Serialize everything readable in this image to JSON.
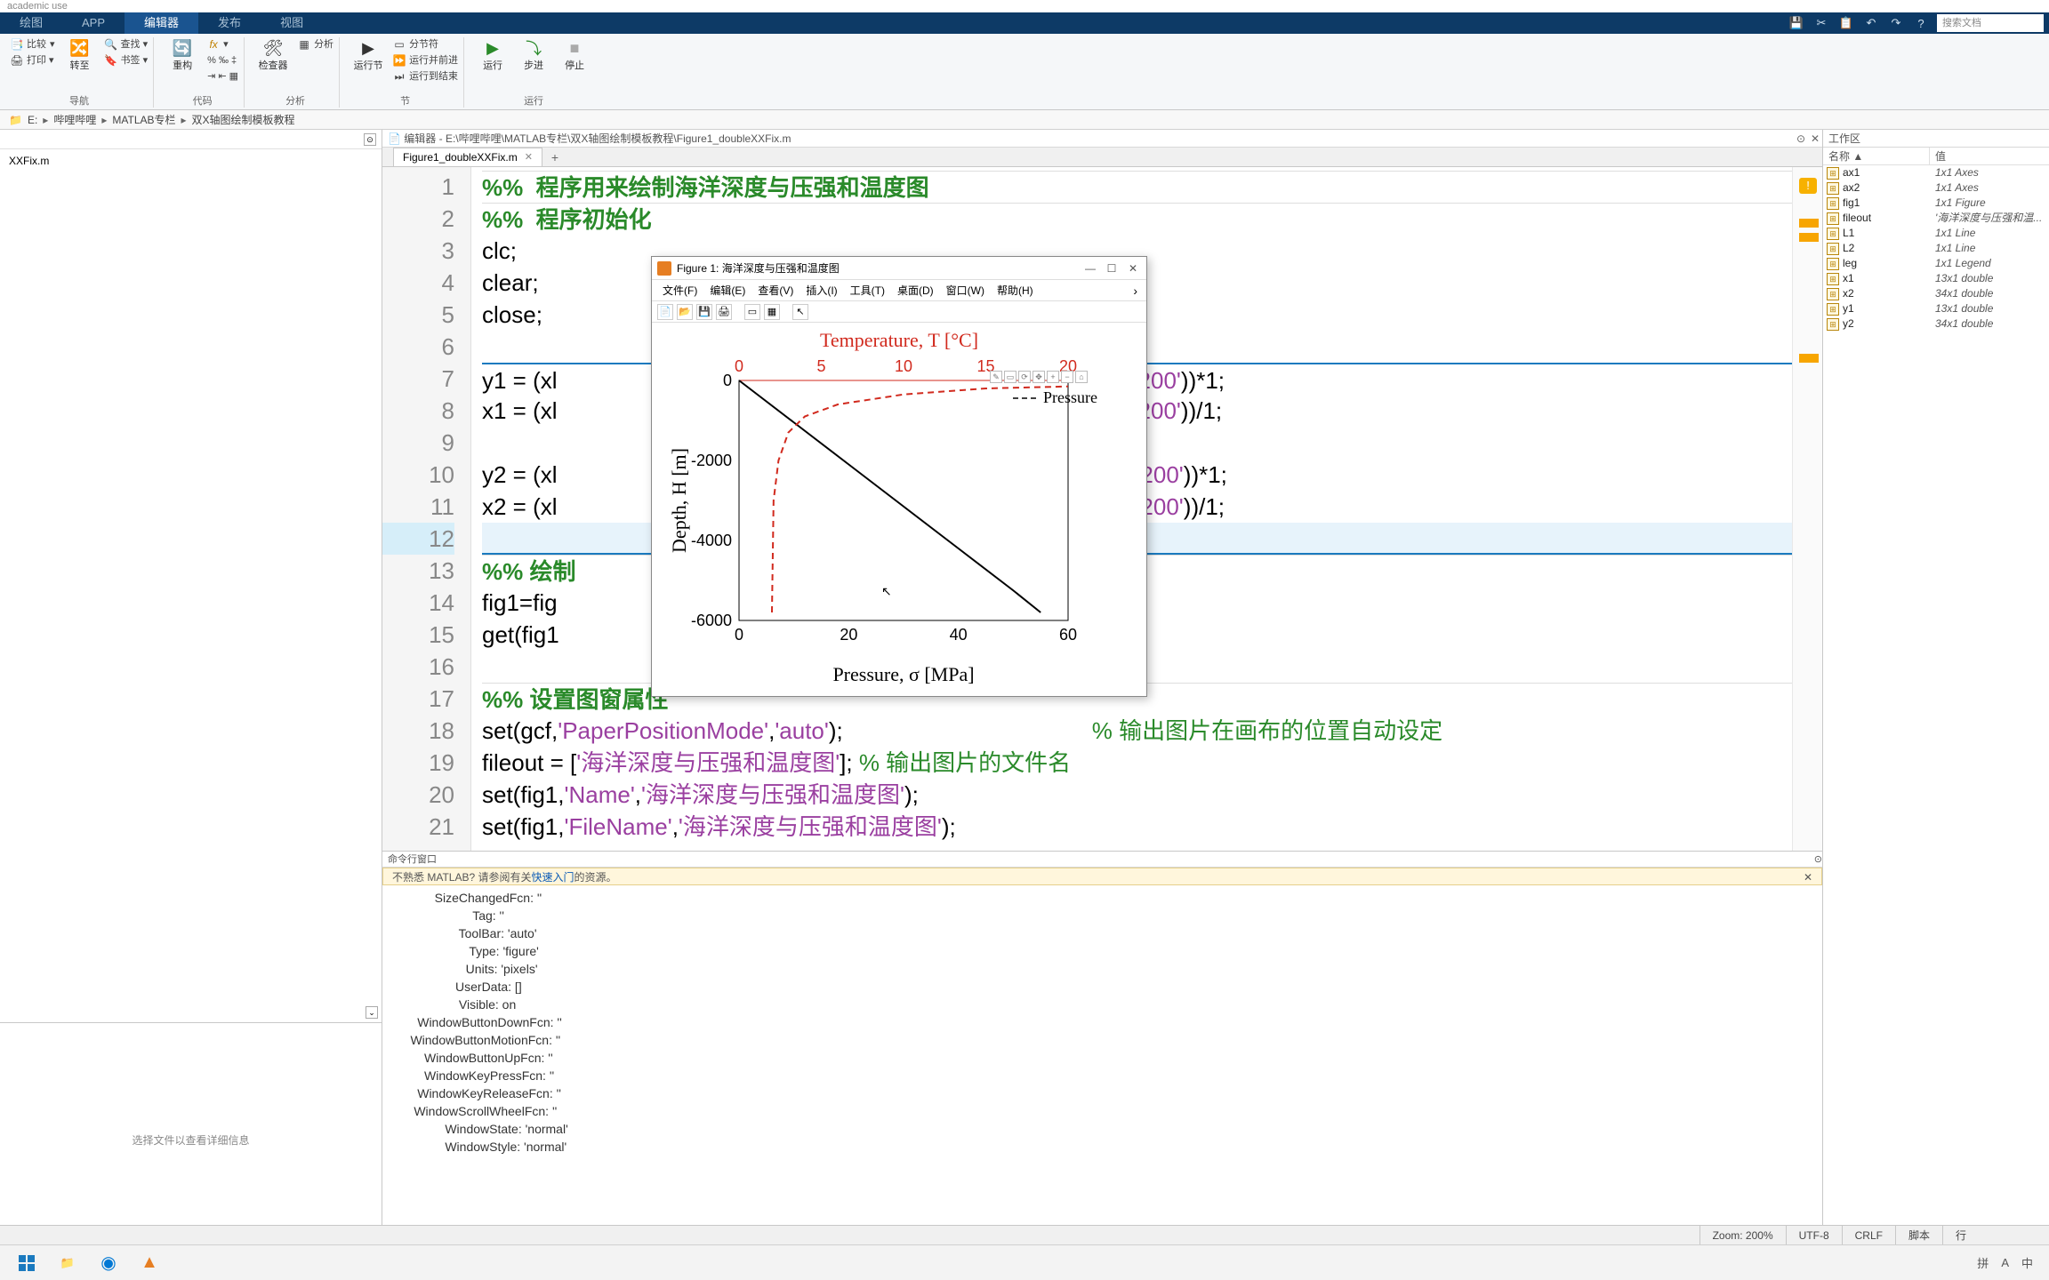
{
  "app_title": "academic use",
  "ribbon_tabs": {
    "t0": "绘图",
    "t1": "APP",
    "t2": "编辑器",
    "t3": "发布",
    "t4": "视图"
  },
  "ribbon_right": {
    "search_placeholder": "搜索文档"
  },
  "ribbon": {
    "file": {
      "compare": "比较",
      "compare_sub": "▾",
      "print": "打印 ▾",
      "goto": "转至",
      "find": "查找 ▾",
      "bookmark": "书签 ▾",
      "refactor": "重构",
      "lbl_file": "导航"
    },
    "code": {
      "fx": "fx",
      "pct": "% ‰ ‡",
      "indent": "⇥ ⇤ ▦",
      "lbl": "代码"
    },
    "analyze": {
      "checker": "检查器",
      "analyze": "分析",
      "lbl": "分析"
    },
    "section": {
      "run_section": "运行节",
      "split": "分节符",
      "run_advance": "运行并前进",
      "run_to_end": "运行到结束",
      "lbl": "节"
    },
    "run": {
      "run": "运行",
      "step": "步进",
      "stop": "停止",
      "lbl": "运行"
    }
  },
  "breadcrumbs": {
    "drive": "E:",
    "p1": "哔哩哔哩",
    "p2": "MATLAB专栏",
    "p3": "双X轴图绘制模板教程"
  },
  "left_panel": {
    "file": "XXFix.m",
    "detail_hint": "选择文件以查看详细信息"
  },
  "editor": {
    "title_prefix": "编辑器 - E:\\哔哩哔哩\\MATLAB专栏\\双X轴图绘制模板教程\\Figure1_doubleXXFix.m",
    "tab": "Figure1_doubleXXFix.m",
    "lines": [
      {
        "n": 1,
        "sec": true,
        "html": "%%  程序用来绘制海洋深度与压强和温度图",
        "cls": "c-sec"
      },
      {
        "n": 2,
        "sec": true,
        "html": "%%  程序初始化",
        "cls": "c-sec"
      },
      {
        "n": 3,
        "html": "clc;",
        "cls": "c-key"
      },
      {
        "n": 4,
        "html": "clear;",
        "cls": "c-key"
      },
      {
        "n": 5,
        "html": "close;",
        "cls": "c-key"
      },
      {
        "n": 6,
        "html": "",
        "cls": ""
      },
      {
        "n": 7,
        "html": "y1 = (xl",
        "tail": ",'A3:A1200'))*1;",
        "cls": "c-key"
      },
      {
        "n": 8,
        "html": "x1 = (xl",
        "tail": ",'B3:B1200'))/1;",
        "cls": "c-key"
      },
      {
        "n": 9,
        "html": "",
        "cls": ""
      },
      {
        "n": 10,
        "html": "y2 = (xl",
        "tail": ",'C1:C1200'))*1;",
        "cls": "c-key"
      },
      {
        "n": 11,
        "html": "x2 = (xl",
        "tail": ",'D1:D1200'))/1;",
        "cls": "c-key"
      },
      {
        "n": 12,
        "html": "",
        "cls": "",
        "cur": true
      },
      {
        "n": 13,
        "sec": true,
        "html": "%% 绘制",
        "cls": "c-sec"
      },
      {
        "n": 14,
        "html": "fig1=fig",
        "cls": "c-key"
      },
      {
        "n": 15,
        "html": "get(fig1",
        "cls": "c-key"
      },
      {
        "n": 16,
        "html": "",
        "cls": ""
      },
      {
        "n": 17,
        "sec": true,
        "html": "%% 设置图窗属性",
        "cls": "c-sec"
      },
      {
        "n": 18,
        "html": "set(gcf,'PaperPositionMode','auto');",
        "cls": "mix",
        "comment": "% 输出图片在画布的位置自动设定"
      },
      {
        "n": 19,
        "html": "fileout = ['海洋深度与压强和温度图']; % 输出图片的文件名",
        "cls": "mix2"
      },
      {
        "n": 20,
        "html": "set(fig1,'Name','海洋深度与压强和温度图');",
        "cls": "mix"
      },
      {
        "n": 21,
        "html": "set(fig1,'FileName','海洋深度与压强和温度图');",
        "cls": "mix"
      }
    ]
  },
  "cmd": {
    "title": "命令行窗口",
    "banner_pre": "不熟悉 MATLAB? 请参阅有关",
    "banner_link": "快速入门",
    "banner_post": "的资源。",
    "props": [
      [
        "SizeChangedFcn",
        "''"
      ],
      [
        "Tag",
        "''"
      ],
      [
        "ToolBar",
        "'auto'"
      ],
      [
        "Type",
        "'figure'"
      ],
      [
        "Units",
        "'pixels'"
      ],
      [
        "UserData",
        "[]"
      ],
      [
        "Visible",
        "on"
      ],
      [
        "WindowButtonDownFcn",
        "''"
      ],
      [
        "WindowButtonMotionFcn",
        "''"
      ],
      [
        "WindowButtonUpFcn",
        "''"
      ],
      [
        "WindowKeyPressFcn",
        "''"
      ],
      [
        "WindowKeyReleaseFcn",
        "''"
      ],
      [
        "WindowScrollWheelFcn",
        "''"
      ],
      [
        "WindowState",
        "'normal'"
      ],
      [
        "WindowStyle",
        "'normal'"
      ]
    ],
    "prompt": ">> "
  },
  "workspace": {
    "title": "工作区",
    "col1": "名称 ▲",
    "col2": "值",
    "rows": [
      {
        "n": "ax1",
        "v": "1x1 Axes"
      },
      {
        "n": "ax2",
        "v": "1x1 Axes"
      },
      {
        "n": "fig1",
        "v": "1x1 Figure"
      },
      {
        "n": "fileout",
        "v": "'海洋深度与压强和温..."
      },
      {
        "n": "L1",
        "v": "1x1 Line"
      },
      {
        "n": "L2",
        "v": "1x1 Line"
      },
      {
        "n": "leg",
        "v": "1x1 Legend"
      },
      {
        "n": "x1",
        "v": "13x1 double"
      },
      {
        "n": "x2",
        "v": "34x1 double"
      },
      {
        "n": "y1",
        "v": "13x1 double"
      },
      {
        "n": "y2",
        "v": "34x1 double"
      }
    ]
  },
  "status": {
    "zoom": "Zoom: 200%",
    "enc": "UTF-8",
    "eol": "CRLF",
    "ft": "脚本",
    "ln": "行"
  },
  "tray": {
    "pinyin": "拼",
    "a": "A",
    "zh": "中"
  },
  "figure": {
    "title": "Figure 1: 海洋深度与压强和温度图",
    "menus": [
      "文件(F)",
      "编辑(E)",
      "查看(V)",
      "插入(I)",
      "工具(T)",
      "桌面(D)",
      "窗口(W)",
      "帮助(H)"
    ],
    "legend": "Pressure"
  },
  "chart_data": {
    "type": "line",
    "title": "",
    "x_bottom_label": "Pressure, σ [MPa]",
    "x_top_label": "Temperature, T [°C]",
    "y_label": "Depth, H [m]",
    "x_bottom_ticks": [
      0,
      20,
      40,
      60
    ],
    "x_top_ticks": [
      0,
      5,
      10,
      15,
      20
    ],
    "y_ticks": [
      0,
      -2000,
      -4000,
      -6000
    ],
    "y_lim": [
      -6000,
      0
    ],
    "x_bottom_lim": [
      0,
      60
    ],
    "x_top_lim": [
      0,
      20
    ],
    "series": [
      {
        "name": "Pressure",
        "axis": "bottom",
        "color": "#000",
        "style": "solid",
        "x": [
          0,
          10,
          20,
          30,
          40,
          50,
          55
        ],
        "y": [
          0,
          -1050,
          -2100,
          -3150,
          -4200,
          -5250,
          -5800
        ]
      },
      {
        "name": "Temperature",
        "axis": "top",
        "color": "#d12a1e",
        "style": "dashed",
        "x": [
          2,
          2.1,
          2.4,
          3,
          4,
          6,
          10,
          15,
          20
        ],
        "y": [
          -5800,
          -3000,
          -2000,
          -1300,
          -900,
          -600,
          -350,
          -200,
          -150
        ]
      }
    ],
    "legend_entries": [
      "Pressure"
    ]
  }
}
